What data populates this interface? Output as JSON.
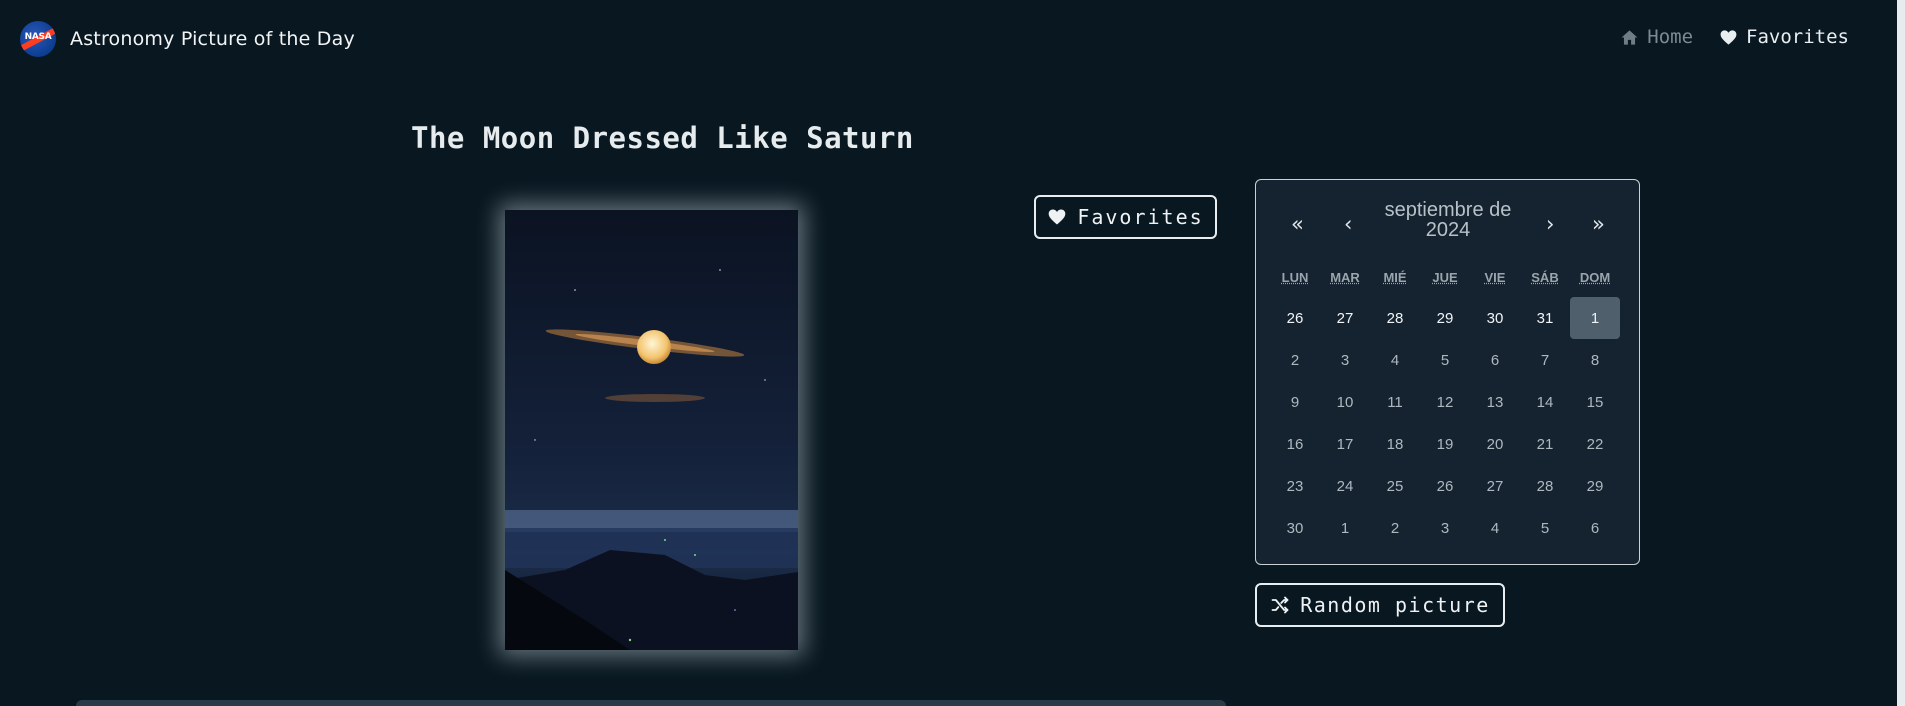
{
  "navbar": {
    "logo_text": "NASA",
    "brand_title": "Astronomy Picture of the Day",
    "links": [
      {
        "label": "Home",
        "icon": "home-icon"
      },
      {
        "label": "Favorites",
        "icon": "heart-icon"
      }
    ]
  },
  "picture": {
    "title": "The Moon Dressed Like Saturn"
  },
  "actions": {
    "favorites_label": "Favorites",
    "random_label": "Random picture",
    "random_icon": "shuffle-icon"
  },
  "calendar": {
    "month_label": "septiembre de 2024",
    "nav": {
      "prev_year": "«",
      "prev_month": "‹",
      "next_month": "›",
      "next_year": "»"
    },
    "weekdays": [
      "LUN",
      "MAR",
      "MIÉ",
      "JUE",
      "VIE",
      "SÁB",
      "DOM"
    ],
    "weeks": [
      [
        "26",
        "27",
        "28",
        "29",
        "30",
        "31",
        "1"
      ],
      [
        "2",
        "3",
        "4",
        "5",
        "6",
        "7",
        "8"
      ],
      [
        "9",
        "10",
        "11",
        "12",
        "13",
        "14",
        "15"
      ],
      [
        "16",
        "17",
        "18",
        "19",
        "20",
        "21",
        "22"
      ],
      [
        "23",
        "24",
        "25",
        "26",
        "27",
        "28",
        "29"
      ],
      [
        "30",
        "1",
        "2",
        "3",
        "4",
        "5",
        "6"
      ]
    ],
    "selected_day": "1"
  },
  "colors": {
    "background": "#081720",
    "calendar_bg": "#152330",
    "selected_day_bg": "#4f5f6c"
  }
}
